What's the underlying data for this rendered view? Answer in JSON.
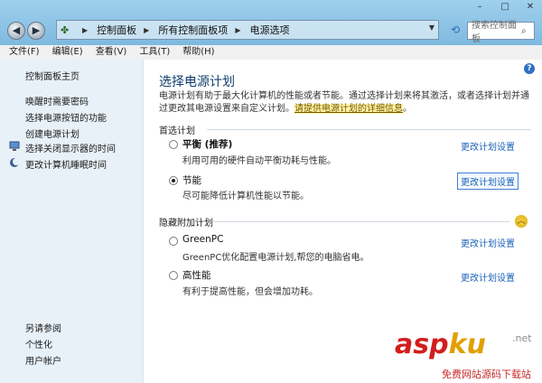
{
  "address": {
    "crumbs": [
      "控制面板",
      "所有控制面板项",
      "电源选项"
    ]
  },
  "search": {
    "placeholder": "搜索控制面板"
  },
  "menu": [
    "文件(F)",
    "编辑(E)",
    "查看(V)",
    "工具(T)",
    "帮助(H)"
  ],
  "sidebar": {
    "home": "控制面板主页",
    "items": [
      "唤醒时需要密码",
      "选择电源按钮的功能",
      "创建电源计划",
      "选择关闭显示器的时间",
      "更改计算机睡眠时间"
    ],
    "see_also_title": "另请参阅",
    "see_also": [
      "个性化",
      "用户帐户"
    ]
  },
  "main": {
    "title": "选择电源计划",
    "desc": "电源计划有助于最大化计算机的性能或者节能。通过选择计划来将其激活，或者选择计划并通过更改其电源设置来自定义计划。",
    "desc_link": "请提供电源计划的详细信息",
    "preferred_label": "首选计划",
    "hidden_label": "隐藏附加计划",
    "change_label": "更改计划设置",
    "plans": [
      {
        "name": "平衡 (推荐)",
        "desc": "利用可用的硬件自动平衡功耗与性能。",
        "selected": false
      },
      {
        "name": "节能",
        "desc": "尽可能降低计算机性能以节能。",
        "selected": true
      },
      {
        "name": "GreenPC",
        "desc": "GreenPC优化配置电源计划,帮您的电脑省电。",
        "selected": false
      },
      {
        "name": "高性能",
        "desc": "有利于提高性能，但会增加功耗。",
        "selected": false
      }
    ]
  },
  "watermark": {
    "logo_a": "asp",
    "logo_b": "ku",
    "net": ".net",
    "sub": "免费网站源码下载站"
  }
}
